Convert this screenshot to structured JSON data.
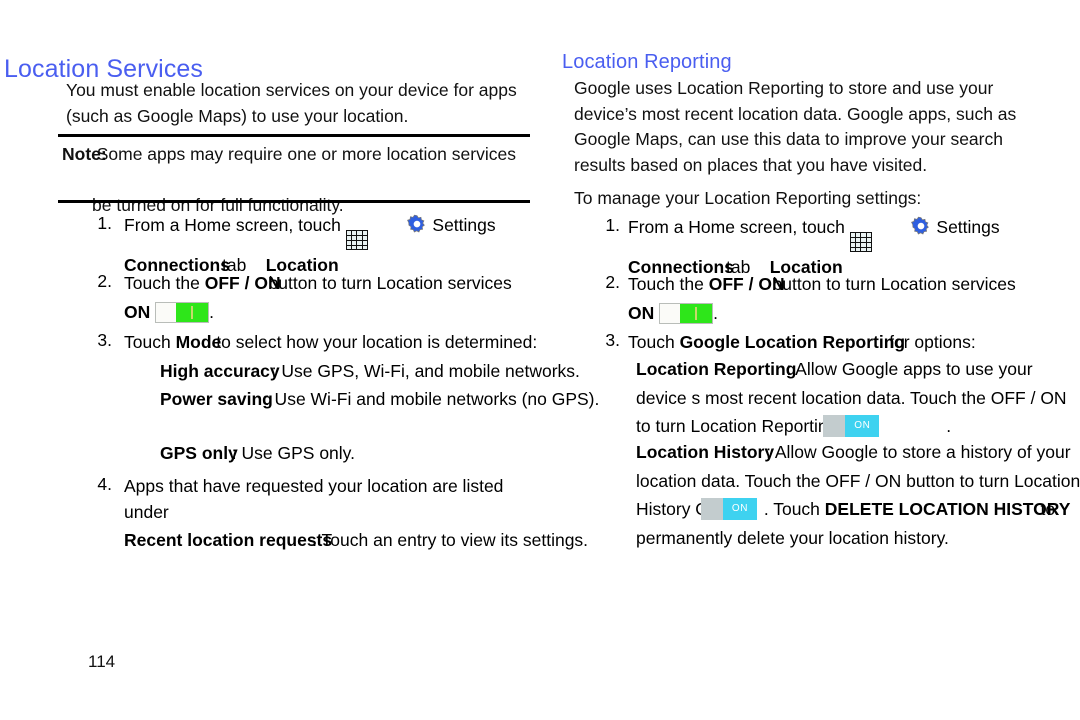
{
  "page": {
    "number": "114",
    "heading_color": "#4a5ef0"
  },
  "left": {
    "title": "Location Services",
    "intro": "You must enable location services on your device for apps (such as Google Maps) to use your location.",
    "note": {
      "label": "Note:",
      "text": "Some apps may require one or more location services be turned on for full functionality.",
      "line1": "Some apps may require one or more location services",
      "line2": "be turned on for full functionality."
    },
    "steps": [
      {
        "num": "1.",
        "pre": "From a Home screen, touch",
        "apps_icon": "apps-grid-icon",
        "gear_icon": "settings-gear-icon",
        "settings_label": "Settings",
        "line2_bold_a": "Connections",
        "line2_mid": "tab",
        "line2_bold_b": "Location"
      },
      {
        "num": "2.",
        "pre": "Touch the ",
        "bold": "OFF / ON",
        "post": "button to turn Location services",
        "on_label": "ON",
        "toggle": "location-services-toggle",
        "toggle_state": "on",
        "period": "."
      },
      {
        "num": "3.",
        "pre": "Touch ",
        "bold": "Mode",
        "post": "to select how your location is determined:",
        "subitems": [
          {
            "bold": "High accuracy",
            "text": ": Use GPS, Wi-Fi, and mobile networks."
          },
          {
            "bold": "Power saving",
            "text": ": Use Wi-Fi and mobile networks (no GPS)."
          },
          {
            "bold": "GPS only",
            "text": ": Use GPS only."
          }
        ]
      },
      {
        "num": "4.",
        "pre": "Apps that have requested your location are listed under",
        "bold": "Recent location requests",
        "post": ". Touch an entry to view its settings."
      }
    ]
  },
  "right": {
    "title": "Location Reporting",
    "intro": "Google uses Location Reporting to store and use your device’s most recent location data. Google apps, such as Google Maps, can use this data to improve your search results based on places that you have visited.",
    "lead": "To manage your Location Reporting settings:",
    "steps": [
      {
        "num": "1.",
        "pre": "From a Home screen, touch",
        "apps_icon": "apps-grid-icon",
        "gear_icon": "settings-gear-icon",
        "settings_label": "Settings",
        "line2_bold_a": "Connections",
        "line2_mid": "tab",
        "line2_bold_b": "Location"
      },
      {
        "num": "2.",
        "pre": "Touch the ",
        "bold": "OFF / ON",
        "post": "button to turn Location services",
        "on_label": "ON",
        "toggle": "location-services-toggle",
        "toggle_state": "on",
        "period": "."
      },
      {
        "num": "3.",
        "pre": "Touch ",
        "bold": "Google Location Reporting",
        "post": "for options:",
        "subitems": [
          {
            "bold": "Location Reporting",
            "l1": ": Allow Google apps to use your",
            "l2": "device s most recent location data. Touch the OFF / ON",
            "l3": "to turn Location Reporting",
            "toggle_label": "ON",
            "l4": "."
          },
          {
            "bold": "Location History",
            "l1": ": Allow Google to store a history of your",
            "l2": "location data. Touch the OFF / ON button to turn Location",
            "l3": "History O",
            "toggle_label": "ON",
            "l4": ". Touch ",
            "l4_bold": "DELETE LOCATION HISTORY",
            "l5": "to",
            "l6": "permanently delete your location history."
          }
        ]
      }
    ]
  }
}
